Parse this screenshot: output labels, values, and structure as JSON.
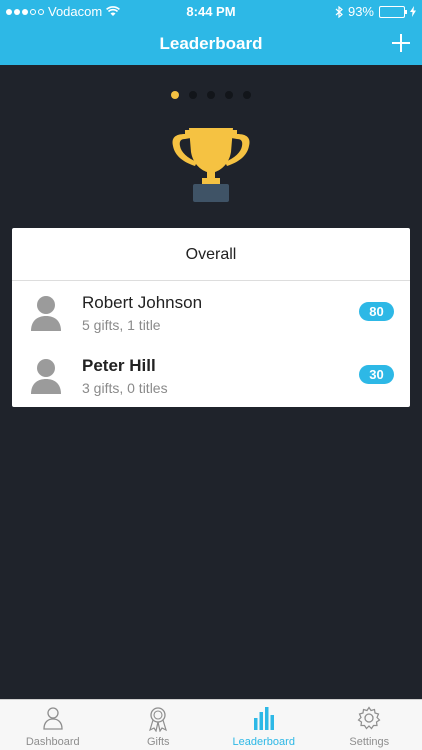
{
  "status_bar": {
    "carrier": "Vodacom",
    "time": "8:44 PM",
    "battery": "93%",
    "battery_level": 0.93
  },
  "nav": {
    "title": "Leaderboard",
    "add_icon": "plus-icon"
  },
  "pager": {
    "pages": 5,
    "active_index": 0,
    "active_color": "#f5c242"
  },
  "card": {
    "title": "Overall",
    "rows": [
      {
        "name": "Robert Johnson",
        "details": "5 gifts, 1 title",
        "score": "80",
        "bold": false
      },
      {
        "name": "Peter Hill",
        "details": "3 gifts, 0 titles",
        "score": "30",
        "bold": true
      }
    ]
  },
  "tabs": [
    {
      "label": "Dashboard",
      "icon": "person-icon",
      "active": false
    },
    {
      "label": "Gifts",
      "icon": "ribbon-icon",
      "active": false
    },
    {
      "label": "Leaderboard",
      "icon": "bar-chart-icon",
      "active": true
    },
    {
      "label": "Settings",
      "icon": "gear-icon",
      "active": false
    }
  ],
  "colors": {
    "accent": "#2db8e6",
    "background": "#1f232b",
    "trophy": "#f5c242"
  }
}
